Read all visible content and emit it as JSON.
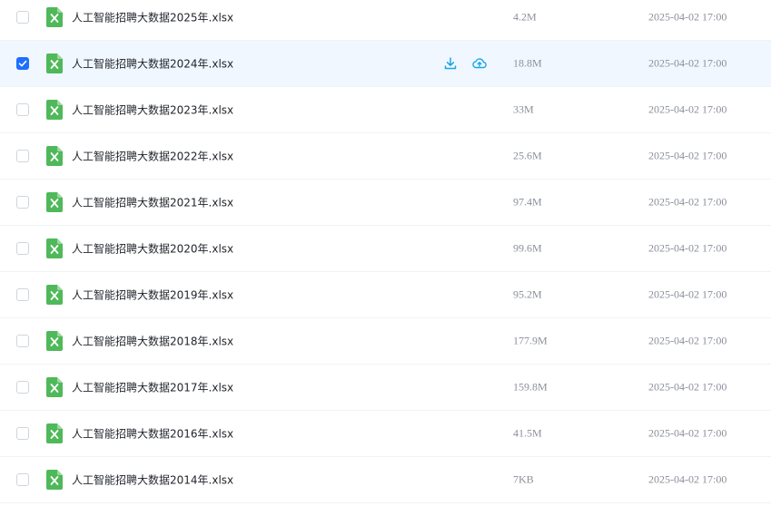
{
  "colors": {
    "accent": "#1e6fff",
    "icon_cyan": "#1aa6e8",
    "excel_green": "#4fb95a",
    "selected_bg": "#f1f7ff"
  },
  "icons": {
    "file": "excel-file-icon",
    "download": "download-icon",
    "cloud": "cloud-upload-icon",
    "check": "checkmark-icon"
  },
  "files": [
    {
      "name": "人工智能招聘大数据2025年.xlsx",
      "size": "4.2M",
      "time": "2025-04-02 17:00",
      "selected": false
    },
    {
      "name": "人工智能招聘大数据2024年.xlsx",
      "size": "18.8M",
      "time": "2025-04-02 17:00",
      "selected": true
    },
    {
      "name": "人工智能招聘大数据2023年.xlsx",
      "size": "33M",
      "time": "2025-04-02 17:00",
      "selected": false
    },
    {
      "name": "人工智能招聘大数据2022年.xlsx",
      "size": "25.6M",
      "time": "2025-04-02 17:00",
      "selected": false
    },
    {
      "name": "人工智能招聘大数据2021年.xlsx",
      "size": "97.4M",
      "time": "2025-04-02 17:00",
      "selected": false
    },
    {
      "name": "人工智能招聘大数据2020年.xlsx",
      "size": "99.6M",
      "time": "2025-04-02 17:00",
      "selected": false
    },
    {
      "name": "人工智能招聘大数据2019年.xlsx",
      "size": "95.2M",
      "time": "2025-04-02 17:00",
      "selected": false
    },
    {
      "name": "人工智能招聘大数据2018年.xlsx",
      "size": "177.9M",
      "time": "2025-04-02 17:00",
      "selected": false
    },
    {
      "name": "人工智能招聘大数据2017年.xlsx",
      "size": "159.8M",
      "time": "2025-04-02 17:00",
      "selected": false
    },
    {
      "name": "人工智能招聘大数据2016年.xlsx",
      "size": "41.5M",
      "time": "2025-04-02 17:00",
      "selected": false
    },
    {
      "name": "人工智能招聘大数据2014年.xlsx",
      "size": "7KB",
      "time": "2025-04-02 17:00",
      "selected": false
    }
  ]
}
